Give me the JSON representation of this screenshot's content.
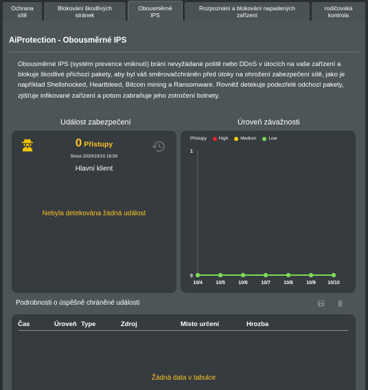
{
  "tabs": [
    {
      "label_lines": [
        "Ochrana",
        "sítě"
      ],
      "active": false
    },
    {
      "label_lines": [
        "Blokování škodlivých",
        "stránek"
      ],
      "active": false
    },
    {
      "label_lines": [
        "Obousměrné",
        "IPS"
      ],
      "active": true
    },
    {
      "label_lines": [
        "Rozpoznání a blokování napadených",
        "zařízení"
      ],
      "active": false
    },
    {
      "label_lines": [
        "rodičovská",
        "kontrola"
      ],
      "active": false
    }
  ],
  "page": {
    "title": "AiProtection - Obousměrné IPS",
    "description": "Obousměrné IPS (systém prevence vniknutí) brání nevyžádané poště nebo DDoS v útocích na vaše zařízení a blokuje škodlivé příchozí pakety, aby byl váš směrovačchráněn před útoky na ohrožení zabezpečení sítě, jako je například Shellshocked, Heartbleed, Bitcoin mining a Ransomware. Rovněž detekuje podezřelé odchozí pakety, zjišťuje infikované zařízení a potom zabraňuje jeho zotročení botnety."
  },
  "security_event": {
    "heading": "Událost zabezpečení",
    "count": "0",
    "count_label": "Přístupy",
    "since": "Since 2020/10/10 16:50",
    "client_label": "Hlavní klient",
    "empty_message": "Nebyla detekována žádná událost",
    "icons": {
      "left": "spy-icon",
      "right": "history-icon"
    }
  },
  "severity": {
    "heading": "Úroveň závažnosti",
    "colors": {
      "line": "#7ed957",
      "high": "#e8242b",
      "medium": "#f5d20a",
      "low": "#7ed957"
    }
  },
  "chart_data": {
    "type": "line",
    "legend_title": "Přístupy",
    "legend": [
      "High",
      "Medium",
      "Low"
    ],
    "categories": [
      "10/4",
      "10/5",
      "10/6",
      "10/7",
      "10/8",
      "10/9",
      "10/10"
    ],
    "series": [
      {
        "name": "Low",
        "values": [
          0,
          0,
          0,
          0,
          0,
          0,
          0
        ]
      }
    ],
    "y_ticks": [
      "0",
      "1"
    ],
    "ylim": [
      0,
      1
    ],
    "legend_position": "top-left"
  },
  "details": {
    "heading": "Podrobnosti o úspěšně chráněné události",
    "columns": [
      "Čas",
      "Úroveň",
      "Type",
      "Zdroj",
      "Místo určení",
      "Hrozba"
    ],
    "empty_message": "Žádná data v tabulce",
    "icons": [
      "save-icon",
      "trash-icon"
    ]
  }
}
